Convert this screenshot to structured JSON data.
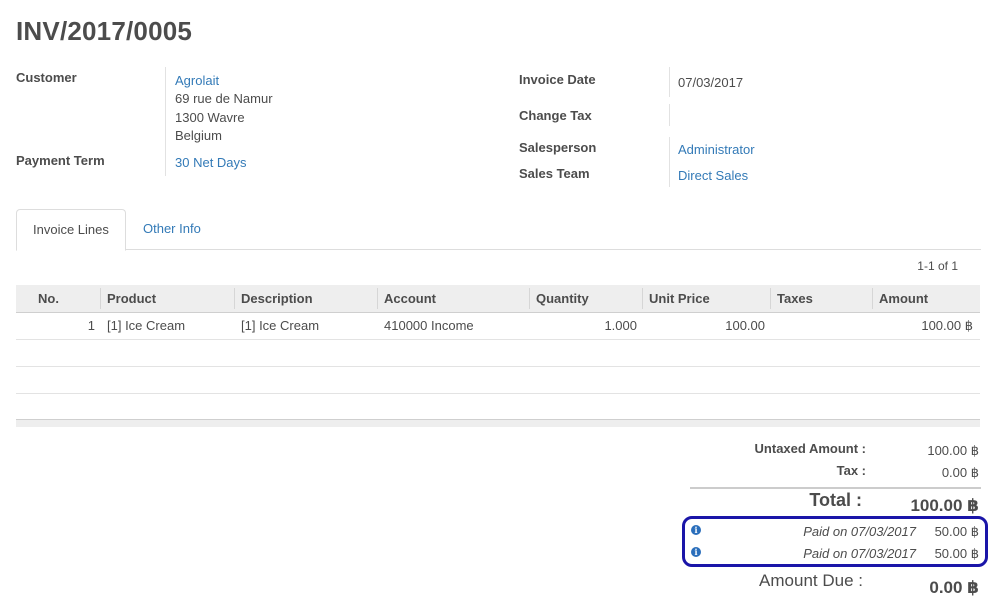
{
  "invoice": {
    "number": "INV/2017/0005"
  },
  "left_fields": {
    "customer_label": "Customer",
    "customer_name": "Agrolait",
    "address_line1": "69 rue de Namur",
    "address_line2": "1300 Wavre",
    "address_line3": "Belgium",
    "payment_term_label": "Payment Term",
    "payment_term_value": "30 Net Days"
  },
  "right_fields": {
    "invoice_date_label": "Invoice Date",
    "invoice_date_value": "07/03/2017",
    "change_tax_label": "Change Tax",
    "salesperson_label": "Salesperson",
    "salesperson_value": "Administrator",
    "sales_team_label": "Sales Team",
    "sales_team_value": "Direct Sales"
  },
  "tabs": [
    {
      "label": "Invoice Lines",
      "active": true
    },
    {
      "label": "Other Info",
      "active": false
    }
  ],
  "pager": "1-1 of 1",
  "table": {
    "columns": [
      "No.",
      "Product",
      "Description",
      "Account",
      "Quantity",
      "Unit Price",
      "Taxes",
      "Amount"
    ],
    "rows": [
      {
        "no": "1",
        "product": "[1] Ice Cream",
        "description": "[1] Ice Cream",
        "account": "410000 Income",
        "quantity": "1.000",
        "unit_price": "100.00",
        "taxes": "",
        "amount": "100.00 ฿"
      }
    ]
  },
  "totals": {
    "untaxed_label": "Untaxed Amount :",
    "untaxed_value": "100.00 ฿",
    "tax_label": "Tax :",
    "tax_value": "0.00 ฿",
    "total_label": "Total :",
    "total_value": "100.00 ฿",
    "payments": [
      {
        "text": "Paid on 07/03/2017",
        "amount": "50.00 ฿",
        "icon": "info-icon"
      },
      {
        "text": "Paid on 07/03/2017",
        "amount": "50.00 ฿",
        "icon": "info-icon"
      }
    ],
    "amount_due_label": "Amount Due :",
    "amount_due_value": "0.00 ฿"
  },
  "colors": {
    "link": "#337ab7",
    "highlight_box": "#1a15a8",
    "info_icon": "#2a6ebb"
  }
}
